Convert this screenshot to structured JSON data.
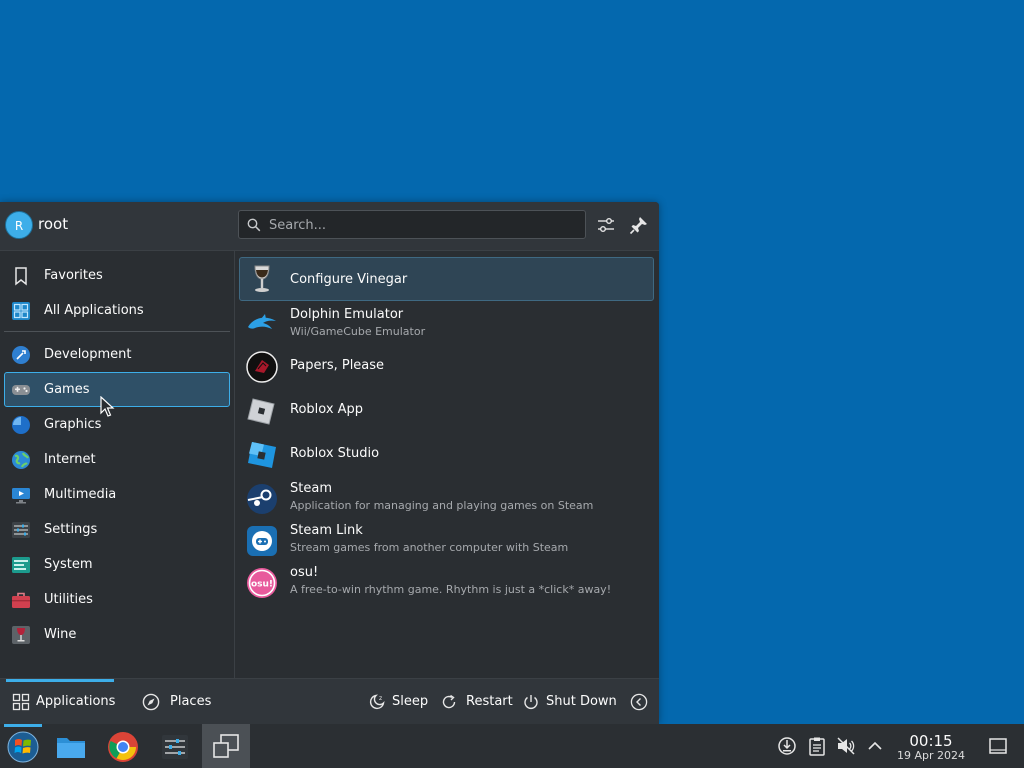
{
  "user": {
    "initial": "R",
    "name": "root"
  },
  "search": {
    "placeholder": "Search..."
  },
  "sidebar": {
    "items": [
      {
        "label": "Favorites",
        "icon": "bookmark-icon"
      },
      {
        "label": "All Applications",
        "icon": "grid-icon"
      },
      {
        "label": "Development",
        "icon": "development-icon"
      },
      {
        "label": "Games",
        "icon": "gamepad-icon",
        "active": true
      },
      {
        "label": "Graphics",
        "icon": "graphics-icon"
      },
      {
        "label": "Internet",
        "icon": "globe-icon"
      },
      {
        "label": "Multimedia",
        "icon": "multimedia-icon"
      },
      {
        "label": "Settings",
        "icon": "settings-icon"
      },
      {
        "label": "System",
        "icon": "system-icon"
      },
      {
        "label": "Utilities",
        "icon": "toolbox-icon"
      },
      {
        "label": "Wine",
        "icon": "wine-icon"
      }
    ]
  },
  "apps": [
    {
      "name": "Configure Vinegar",
      "desc": "",
      "icon": "vinegar-icon",
      "active": true
    },
    {
      "name": "Dolphin Emulator",
      "desc": "Wii/GameCube Emulator",
      "icon": "dolphin-icon"
    },
    {
      "name": "Papers, Please",
      "desc": "",
      "icon": "papers-please-icon"
    },
    {
      "name": "Roblox App",
      "desc": "",
      "icon": "roblox-icon"
    },
    {
      "name": "Roblox Studio",
      "desc": "",
      "icon": "roblox-studio-icon"
    },
    {
      "name": "Steam",
      "desc": "Application for managing and playing games on Steam",
      "icon": "steam-icon"
    },
    {
      "name": "Steam Link",
      "desc": "Stream games from another computer with Steam",
      "icon": "steam-link-icon"
    },
    {
      "name": "osu!",
      "desc": "A free-to-win rhythm game. Rhythm is just a *click* away!",
      "icon": "osu-icon"
    }
  ],
  "footer": {
    "tabs": {
      "applications": "Applications",
      "places": "Places"
    },
    "power": {
      "sleep": "Sleep",
      "restart": "Restart",
      "shutdown": "Shut Down"
    }
  },
  "clock": {
    "time": "00:15",
    "date": "19 Apr 2024"
  },
  "osu_icon_text": "osu!",
  "colors": {
    "accent": "#3daee9",
    "desktop": "#0468ae",
    "panel": "#2a2e32"
  }
}
